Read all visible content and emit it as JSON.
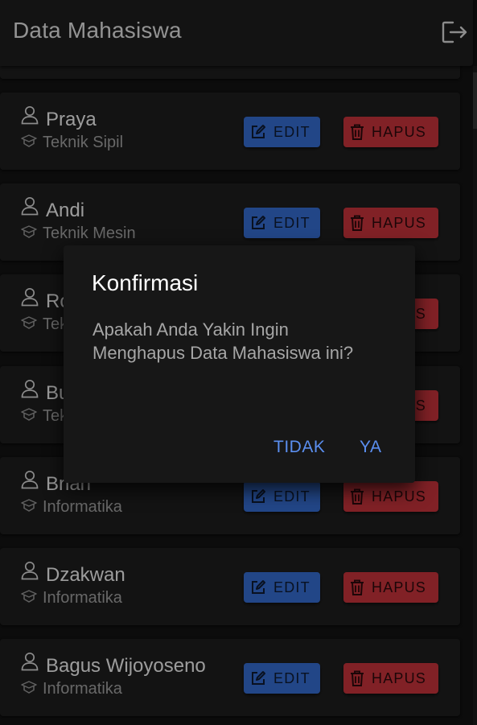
{
  "app": {
    "title": "Data Mahasiswa",
    "logout_icon": "logout-icon"
  },
  "students": [
    {
      "name": "Praya",
      "major": "Teknik Sipil"
    },
    {
      "name": "Andi",
      "major": "Teknik Mesin"
    },
    {
      "name": "Ro",
      "major": "Tek"
    },
    {
      "name": "Bu",
      "major": "Tek"
    },
    {
      "name": "Brian",
      "major": "Informatika"
    },
    {
      "name": "Dzakwan",
      "major": "Informatika"
    },
    {
      "name": "Bagus Wijoyoseno",
      "major": "Informatika"
    }
  ],
  "actions": {
    "edit_label": "EDIT",
    "delete_label": "HAPUS"
  },
  "dialog": {
    "title": "Konfirmasi",
    "message": "Apakah Anda Yakin Ingin Menghapus Data Mahasiswa ini?",
    "cancel_label": "TIDAK",
    "confirm_label": "YA"
  },
  "colors": {
    "edit_button": "#3367c8",
    "delete_button": "#bf3138",
    "dialog_action": "#5b8ff0",
    "background": "#121212",
    "card": "#1d1d1d"
  }
}
